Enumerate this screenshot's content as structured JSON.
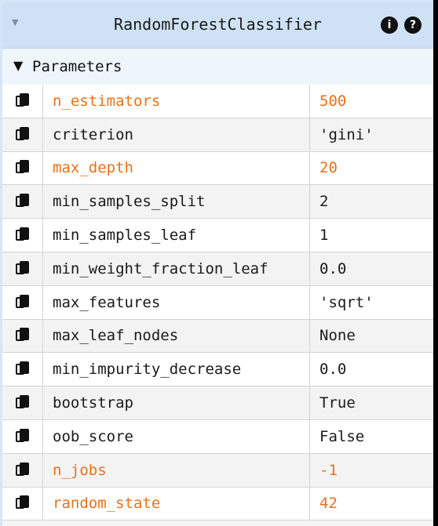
{
  "header": {
    "title": "RandomForestClassifier",
    "info_glyph": "i",
    "help_glyph": "?"
  },
  "section": {
    "title": "Parameters"
  },
  "colors": {
    "header_bg": "#cfe2f5",
    "changed_param": "#e8711a",
    "default_param": "#1a1a1a"
  },
  "params": [
    {
      "name": "n_estimators",
      "value": "500",
      "changed": true
    },
    {
      "name": "criterion",
      "value": "'gini'",
      "changed": false
    },
    {
      "name": "max_depth",
      "value": "20",
      "changed": true
    },
    {
      "name": "min_samples_split",
      "value": "2",
      "changed": false
    },
    {
      "name": "min_samples_leaf",
      "value": "1",
      "changed": false
    },
    {
      "name": "min_weight_fraction_leaf",
      "value": "0.0",
      "changed": false
    },
    {
      "name": "max_features",
      "value": "'sqrt'",
      "changed": false
    },
    {
      "name": "max_leaf_nodes",
      "value": "None",
      "changed": false
    },
    {
      "name": "min_impurity_decrease",
      "value": "0.0",
      "changed": false
    },
    {
      "name": "bootstrap",
      "value": "True",
      "changed": false
    },
    {
      "name": "oob_score",
      "value": "False",
      "changed": false
    },
    {
      "name": "n_jobs",
      "value": "-1",
      "changed": true
    },
    {
      "name": "random_state",
      "value": "42",
      "changed": true
    }
  ]
}
